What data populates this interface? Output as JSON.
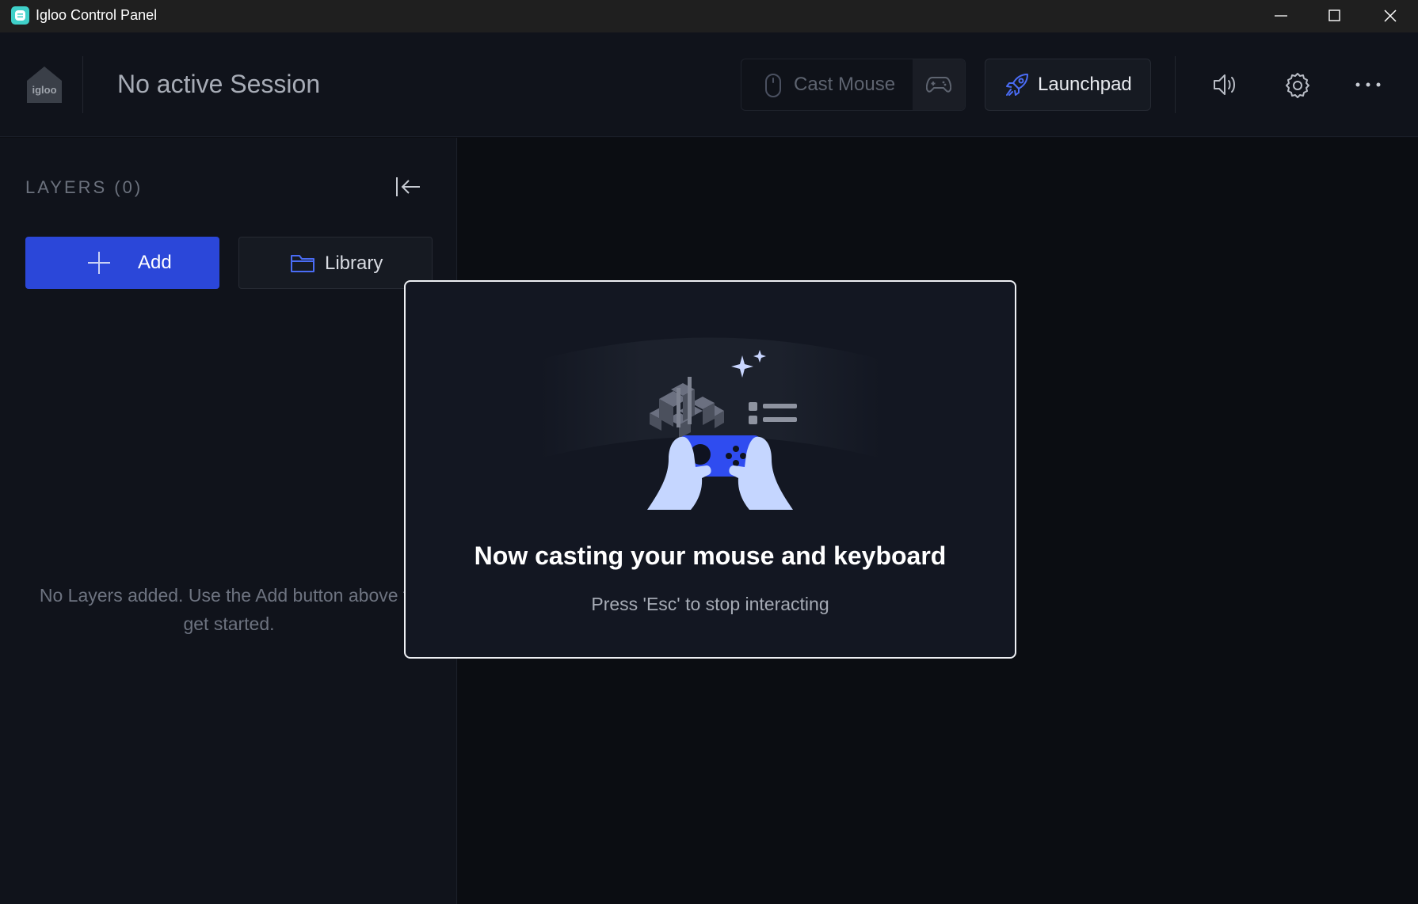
{
  "window": {
    "title": "Igloo Control Panel",
    "icon": "igloo-app-icon",
    "controls": [
      "minimize-icon",
      "maximize-icon",
      "close-icon"
    ]
  },
  "header": {
    "logo_icon": "igloo-home-logo",
    "session_title": "No active Session",
    "cast_mouse": {
      "label": "Cast Mouse",
      "icon": "mouse-icon"
    },
    "cast_gamepad": {
      "icon": "gamepad-icon"
    },
    "launchpad": {
      "label": "Launchpad",
      "icon": "rocket-icon"
    },
    "actions": [
      "speaker-icon",
      "gear-icon",
      "more-dots-icon"
    ]
  },
  "sidebar": {
    "title": "LAYERS (0)",
    "collapse_icon": "collapse-left-icon",
    "add_label": "Add",
    "library_label": "Library",
    "empty_message": "No Layers added. Use the Add button above to get started."
  },
  "modal": {
    "title": "Now casting your mouse and keyboard",
    "subtitle": "Press 'Esc' to stop interacting",
    "illustration": "hands-holding-gamepad-illustration"
  },
  "colors": {
    "accent": "#2b47d9",
    "background": "#0c0e14",
    "panel": "#10131b",
    "modal_bg": "#131722",
    "app_icon": "#3fd0c9"
  }
}
